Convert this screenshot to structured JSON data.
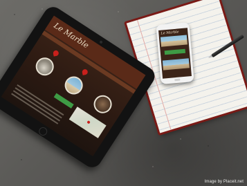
{
  "photo": {
    "tablet_site_logo": "Le Marble",
    "phone_site_logo": "Le Marble",
    "credit": "Image by Placeit.net"
  },
  "colors": {
    "concrete": "#5b5a57",
    "site_brown": "#3d2418",
    "accent_green": "#3e9b45",
    "notebook_cover": "#7a1a16",
    "pin_red": "#c8201c"
  }
}
